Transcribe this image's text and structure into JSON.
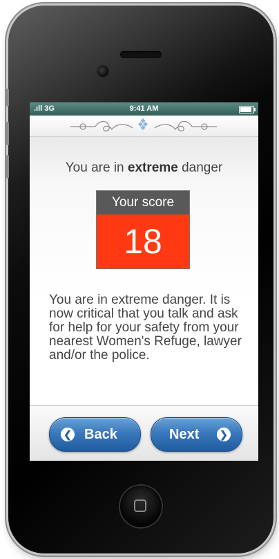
{
  "status_bar": {
    "signal": ".ıll 3G",
    "time": "9:41 AM",
    "battery_icon": "battery-icon"
  },
  "header": {
    "ornament_icon": "decorative-flourish-icon"
  },
  "result": {
    "heading_prefix": "You are in ",
    "heading_bold": "extreme",
    "heading_suffix": " danger"
  },
  "score": {
    "label": "Your score",
    "value": "18",
    "value_color": "#ff3a12",
    "label_color": "#595959"
  },
  "message": "You are in extreme danger. It is now critical that you talk and ask for help for your safety from your nearest Women's Refuge, lawyer and/or the police.",
  "nav": {
    "back_label": "Back",
    "next_label": "Next",
    "back_icon": "chevron-left-icon",
    "next_icon": "chevron-right-icon",
    "button_color": "#3a79bd"
  },
  "device": {
    "home_icon": "home-button-icon"
  }
}
